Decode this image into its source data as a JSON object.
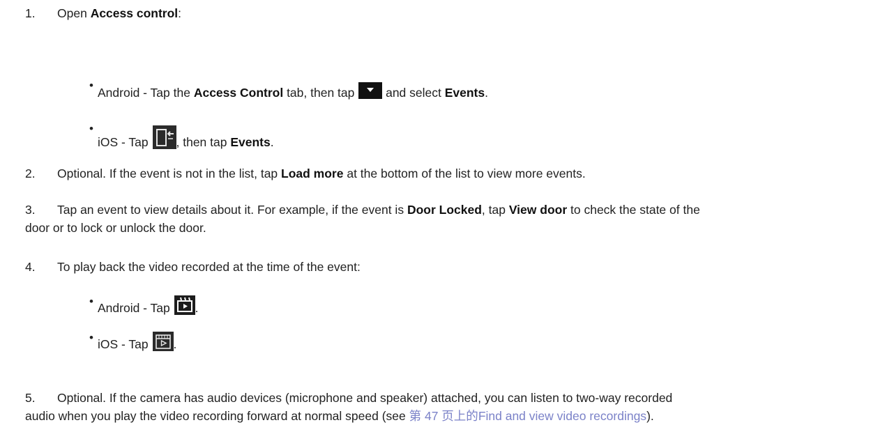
{
  "steps": [
    {
      "num": "1.",
      "pre": "Open ",
      "b1": "Access control",
      "post": ":"
    },
    {
      "num": "2.",
      "pre": "Optional. If the event is not in the list, tap ",
      "b1": "Load more",
      "post": " at the bottom of the list to view more events."
    },
    {
      "num": "3.",
      "pre": "Tap an event to view details about it. For example, if the event is ",
      "b1": "Door Locked",
      "mid": ", tap ",
      "b2": "View door",
      "post": " to check the state of the",
      "line2": "door or to lock or unlock the door."
    },
    {
      "num": "4.",
      "text": "To play back the video recorded at the time of the event:"
    },
    {
      "num": "5.",
      "line1": "Optional. If the camera has audio devices (microphone and speaker) attached, you can listen to two-way recorded",
      "line2_pre": "audio when you play the video recording forward at normal speed (see ",
      "link_pre": "第 47 页上的",
      "link": "Find and view video recordings",
      "line2_post": ")."
    }
  ],
  "bullets_1": [
    {
      "t1": "Android - Tap the ",
      "b1": "Access Control",
      "t2": " tab, then tap ",
      "icon": "dropdown-arrow-icon",
      "t3": " and select ",
      "b2": "Events",
      "t4": "."
    },
    {
      "t1": "iOS - Tap ",
      "icon": "door-exit-icon",
      "t2": ", then tap ",
      "b1": "Events",
      "t3": "."
    }
  ],
  "bullets_4": [
    {
      "t1": "Android - Tap ",
      "icon": "video-playback-icon",
      "t2": "."
    },
    {
      "t1": "iOS - Tap ",
      "icon": "video-playback-icon",
      "t2": "."
    }
  ],
  "bullet_char": "•"
}
